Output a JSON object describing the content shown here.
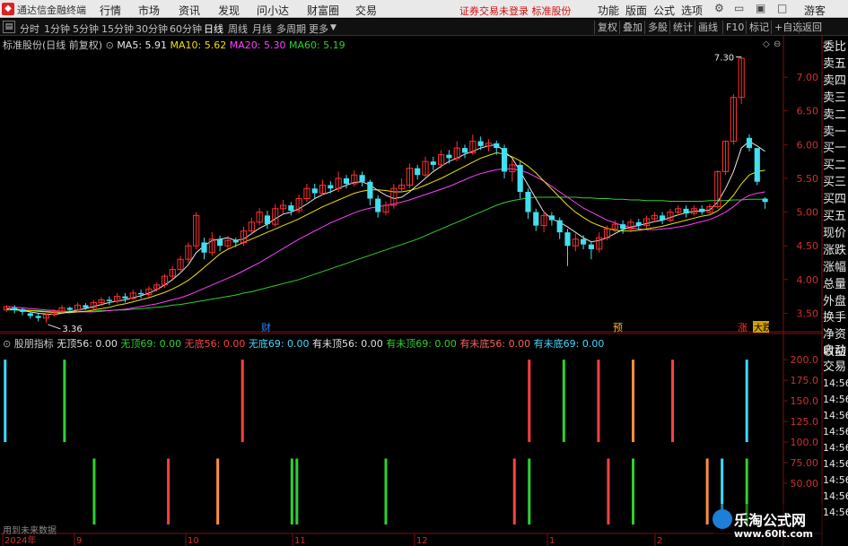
{
  "menubar": {
    "title": "通达信金融终端",
    "items": [
      "行情",
      "市场",
      "资讯",
      "发现",
      "问小达",
      "财富圈",
      "交易"
    ],
    "warning": "证券交易未登录  标准股份",
    "right_items": [
      "功能",
      "版面",
      "公式",
      "选项"
    ],
    "user": "游客"
  },
  "toolbar": {
    "periods": [
      "分时",
      "1分钟",
      "5分钟",
      "15分钟",
      "30分钟",
      "60分钟",
      "日线",
      "周线",
      "月线",
      "多周期",
      "更多"
    ],
    "active_period": "日线",
    "right_buttons": [
      "复权",
      "叠加",
      "多股",
      "统计",
      "画线",
      "F10",
      "标记",
      "+自选",
      "返回"
    ]
  },
  "main_legend": {
    "stock": "标准股份(日线 前复权)",
    "ma": [
      {
        "label": "MA5: 5.91",
        "color": "#e8e8e8"
      },
      {
        "label": "MA10: 5.62",
        "color": "#f0e000"
      },
      {
        "label": "MA20: 5.30",
        "color": "#ff40ff"
      },
      {
        "label": "MA60: 5.19",
        "color": "#30d030"
      }
    ]
  },
  "indicator": {
    "name": "股朋指标",
    "values": [
      {
        "label": "无顶56: 0.00",
        "color": "#e0e0e0"
      },
      {
        "label": "无顶69: 0.00",
        "color": "#30d030"
      },
      {
        "label": "无底56: 0.00",
        "color": "#ff4040"
      },
      {
        "label": "无底69: 0.00",
        "color": "#40d8ff"
      },
      {
        "label": "有未顶56: 0.00",
        "color": "#e0e0e0"
      },
      {
        "label": "有未顶69: 0.00",
        "color": "#30d030"
      },
      {
        "label": "有未底56: 0.00",
        "color": "#ff6060"
      },
      {
        "label": "有未底69: 0.00",
        "color": "#40d8ff"
      }
    ]
  },
  "price_axis": [
    "7.00",
    "6.50",
    "6.00",
    "5.50",
    "5.00",
    "4.50",
    "4.00",
    "3.50"
  ],
  "indicator_axis": [
    "200.0",
    "175.0",
    "150.0",
    "125.0",
    "100.0",
    "75.00",
    "50.00"
  ],
  "date_axis": [
    "2024年",
    "9",
    "10",
    "11",
    "12",
    "1",
    "2"
  ],
  "annotations": {
    "high": "7.30",
    "low": "3.36",
    "marker_cai": "财",
    "marker_yu": "预",
    "marker_zhang": "涨",
    "marker_tag": "大跌"
  },
  "side_list": [
    "委比",
    "卖五",
    "卖四",
    "卖三",
    "卖二",
    "卖一",
    "买一",
    "买二",
    "买三",
    "买四",
    "买五",
    "现价",
    "涨跌",
    "涨幅",
    "总量",
    "外盘",
    "换手",
    "净资",
    "收益"
  ],
  "side_list_lower": [
    "自动",
    "交易",
    "14:56",
    "14:56",
    "14:56",
    "14:56",
    "14:56",
    "14:56",
    "14:56",
    "14:56",
    "14:56"
  ],
  "note": "用到未来数据",
  "watermark": {
    "cn": "乐淘公式网",
    "url": "www.60lt.com"
  },
  "chart_data": {
    "type": "candlestick",
    "ylim": [
      3.2,
      7.4
    ],
    "candles": [
      [
        3.55,
        3.6,
        3.52,
        3.62
      ],
      [
        3.58,
        3.56,
        3.5,
        3.62
      ],
      [
        3.56,
        3.52,
        3.47,
        3.58
      ],
      [
        3.5,
        3.46,
        3.42,
        3.53
      ],
      [
        3.46,
        3.43,
        3.38,
        3.5
      ],
      [
        3.43,
        3.48,
        3.36,
        3.5
      ],
      [
        3.48,
        3.53,
        3.45,
        3.56
      ],
      [
        3.53,
        3.58,
        3.5,
        3.62
      ],
      [
        3.58,
        3.55,
        3.5,
        3.6
      ],
      [
        3.55,
        3.62,
        3.52,
        3.66
      ],
      [
        3.62,
        3.58,
        3.55,
        3.65
      ],
      [
        3.58,
        3.66,
        3.56,
        3.7
      ],
      [
        3.66,
        3.7,
        3.6,
        3.74
      ],
      [
        3.7,
        3.68,
        3.62,
        3.75
      ],
      [
        3.68,
        3.75,
        3.65,
        3.8
      ],
      [
        3.75,
        3.72,
        3.66,
        3.8
      ],
      [
        3.72,
        3.8,
        3.7,
        3.85
      ],
      [
        3.8,
        3.78,
        3.72,
        3.85
      ],
      [
        3.78,
        3.86,
        3.74,
        3.9
      ],
      [
        3.86,
        3.92,
        3.82,
        3.96
      ],
      [
        3.92,
        4.05,
        3.88,
        4.08
      ],
      [
        4.05,
        4.15,
        4.0,
        4.2
      ],
      [
        4.15,
        4.3,
        4.1,
        4.35
      ],
      [
        4.3,
        4.5,
        4.25,
        4.55
      ],
      [
        4.5,
        4.95,
        4.45,
        5.0
      ],
      [
        4.55,
        4.4,
        4.3,
        4.62
      ],
      [
        4.4,
        4.6,
        4.35,
        4.7
      ],
      [
        4.6,
        4.5,
        4.42,
        4.65
      ],
      [
        4.5,
        4.58,
        4.45,
        4.65
      ],
      [
        4.58,
        4.55,
        4.48,
        4.62
      ],
      [
        4.55,
        4.72,
        4.5,
        4.78
      ],
      [
        4.72,
        4.85,
        4.68,
        4.92
      ],
      [
        4.85,
        5.0,
        4.8,
        5.06
      ],
      [
        4.95,
        4.82,
        4.75,
        5.02
      ],
      [
        4.82,
        5.05,
        4.78,
        5.12
      ],
      [
        5.05,
        5.1,
        4.98,
        5.18
      ],
      [
        5.1,
        5.02,
        4.95,
        5.15
      ],
      [
        5.02,
        5.2,
        4.98,
        5.26
      ],
      [
        5.2,
        5.35,
        5.15,
        5.42
      ],
      [
        5.35,
        5.28,
        5.2,
        5.42
      ],
      [
        5.28,
        5.4,
        5.25,
        5.48
      ],
      [
        5.4,
        5.35,
        5.28,
        5.46
      ],
      [
        5.35,
        5.5,
        5.3,
        5.6
      ],
      [
        5.5,
        5.42,
        5.35,
        5.55
      ],
      [
        5.42,
        5.55,
        5.38,
        5.62
      ],
      [
        5.55,
        5.45,
        5.38,
        5.6
      ],
      [
        5.45,
        5.2,
        5.1,
        5.48
      ],
      [
        5.2,
        5.0,
        4.92,
        5.25
      ],
      [
        5.0,
        5.1,
        4.95,
        5.16
      ],
      [
        5.1,
        5.35,
        5.05,
        5.42
      ],
      [
        5.35,
        5.4,
        5.3,
        5.5
      ],
      [
        5.4,
        5.65,
        5.35,
        5.72
      ],
      [
        5.65,
        5.55,
        5.48,
        5.7
      ],
      [
        5.55,
        5.75,
        5.5,
        5.82
      ],
      [
        5.75,
        5.7,
        5.62,
        5.82
      ],
      [
        5.7,
        5.85,
        5.65,
        5.92
      ],
      [
        5.85,
        5.8,
        5.72,
        5.92
      ],
      [
        5.8,
        5.95,
        5.75,
        6.05
      ],
      [
        5.95,
        5.88,
        5.8,
        6.0
      ],
      [
        5.88,
        6.05,
        5.85,
        6.15
      ],
      [
        6.05,
        5.98,
        5.92,
        6.12
      ],
      [
        5.98,
        6.02,
        5.9,
        6.08
      ],
      [
        6.02,
        5.95,
        5.85,
        6.06
      ],
      [
        5.95,
        5.6,
        5.5,
        6.0
      ],
      [
        5.6,
        5.7,
        5.45,
        5.78
      ],
      [
        5.7,
        5.3,
        5.2,
        5.75
      ],
      [
        5.3,
        5.0,
        4.9,
        5.35
      ],
      [
        5.0,
        4.8,
        4.72,
        5.05
      ],
      [
        4.8,
        4.95,
        4.7,
        5.02
      ],
      [
        4.95,
        4.88,
        4.8,
        5.0
      ],
      [
        4.88,
        4.7,
        4.6,
        4.92
      ],
      [
        4.7,
        4.5,
        4.2,
        4.75
      ],
      [
        4.5,
        4.6,
        4.42,
        4.68
      ],
      [
        4.6,
        4.52,
        4.45,
        4.66
      ],
      [
        4.52,
        4.45,
        4.3,
        4.56
      ],
      [
        4.45,
        4.62,
        4.4,
        4.7
      ],
      [
        4.62,
        4.75,
        4.58,
        4.8
      ],
      [
        4.75,
        4.82,
        4.7,
        4.88
      ],
      [
        4.82,
        4.75,
        4.68,
        4.88
      ],
      [
        4.75,
        4.85,
        4.7,
        4.9
      ],
      [
        4.85,
        4.8,
        4.74,
        4.9
      ],
      [
        4.8,
        4.9,
        4.76,
        4.95
      ],
      [
        4.9,
        4.95,
        4.85,
        5.0
      ],
      [
        4.95,
        4.88,
        4.82,
        5.0
      ],
      [
        4.88,
        5.0,
        4.85,
        5.05
      ],
      [
        5.0,
        5.05,
        4.95,
        5.1
      ],
      [
        5.05,
        4.98,
        4.92,
        5.1
      ],
      [
        4.98,
        5.05,
        4.95,
        5.1
      ],
      [
        5.05,
        5.0,
        4.96,
        5.1
      ],
      [
        5.0,
        5.08,
        4.96,
        5.12
      ],
      [
        5.08,
        5.6,
        5.05,
        5.62
      ],
      [
        5.6,
        6.05,
        5.55,
        6.06
      ],
      [
        6.05,
        6.7,
        6.0,
        6.75
      ],
      [
        6.7,
        7.28,
        6.6,
        7.3
      ],
      [
        6.1,
        5.95,
        5.9,
        6.15
      ],
      [
        5.95,
        5.45,
        5.4,
        5.5
      ],
      [
        5.2,
        5.15,
        5.05,
        5.22
      ]
    ],
    "ma5": [
      3.57,
      3.56,
      3.54,
      3.52,
      3.5,
      3.49,
      3.48,
      3.5,
      3.52,
      3.55,
      3.57,
      3.6,
      3.63,
      3.66,
      3.68,
      3.7,
      3.73,
      3.76,
      3.8,
      3.85,
      3.92,
      4.0,
      4.1,
      4.22,
      4.4,
      4.5,
      4.58,
      4.6,
      4.62,
      4.58,
      4.6,
      4.68,
      4.76,
      4.82,
      4.9,
      4.97,
      5.0,
      5.05,
      5.12,
      5.2,
      5.26,
      5.3,
      5.35,
      5.4,
      5.44,
      5.45,
      5.4,
      5.32,
      5.25,
      5.2,
      5.22,
      5.3,
      5.4,
      5.5,
      5.6,
      5.68,
      5.75,
      5.8,
      5.86,
      5.9,
      5.95,
      5.98,
      6.0,
      5.9,
      5.8,
      5.6,
      5.4,
      5.2,
      5.0,
      4.9,
      4.85,
      4.78,
      4.7,
      4.62,
      4.56,
      4.58,
      4.62,
      4.68,
      4.74,
      4.78,
      4.8,
      4.83,
      4.86,
      4.88,
      4.92,
      4.96,
      4.99,
      5.01,
      5.02,
      5.03,
      5.15,
      5.35,
      5.6,
      5.95,
      6.05,
      5.98,
      5.9
    ],
    "ma10": [
      3.56,
      3.56,
      3.55,
      3.54,
      3.53,
      3.52,
      3.51,
      3.51,
      3.51,
      3.52,
      3.53,
      3.55,
      3.57,
      3.59,
      3.62,
      3.64,
      3.67,
      3.7,
      3.73,
      3.77,
      3.81,
      3.86,
      3.92,
      3.99,
      4.08,
      4.18,
      4.28,
      4.38,
      4.45,
      4.5,
      4.55,
      4.6,
      4.65,
      4.7,
      4.75,
      4.8,
      4.85,
      4.9,
      4.96,
      5.02,
      5.08,
      5.13,
      5.18,
      5.23,
      5.28,
      5.31,
      5.33,
      5.33,
      5.32,
      5.3,
      5.3,
      5.32,
      5.35,
      5.4,
      5.45,
      5.5,
      5.56,
      5.62,
      5.68,
      5.74,
      5.8,
      5.84,
      5.88,
      5.86,
      5.82,
      5.76,
      5.68,
      5.58,
      5.46,
      5.34,
      5.22,
      5.1,
      5.0,
      4.92,
      4.85,
      4.8,
      4.76,
      4.73,
      4.72,
      4.72,
      4.73,
      4.75,
      4.77,
      4.79,
      4.82,
      4.85,
      4.88,
      4.91,
      4.94,
      4.96,
      5.02,
      5.12,
      5.25,
      5.42,
      5.55,
      5.6,
      5.62
    ],
    "ma20": [
      3.6,
      3.59,
      3.58,
      3.57,
      3.56,
      3.55,
      3.54,
      3.53,
      3.52,
      3.52,
      3.52,
      3.52,
      3.53,
      3.54,
      3.55,
      3.56,
      3.58,
      3.6,
      3.62,
      3.64,
      3.67,
      3.7,
      3.73,
      3.77,
      3.82,
      3.87,
      3.92,
      3.97,
      4.02,
      4.07,
      4.13,
      4.19,
      4.25,
      4.32,
      4.39,
      4.46,
      4.53,
      4.6,
      4.66,
      4.72,
      4.78,
      4.84,
      4.89,
      4.94,
      4.99,
      5.03,
      5.06,
      5.08,
      5.1,
      5.12,
      5.15,
      5.18,
      5.22,
      5.26,
      5.3,
      5.34,
      5.38,
      5.43,
      5.48,
      5.53,
      5.57,
      5.6,
      5.63,
      5.64,
      5.64,
      5.62,
      5.58,
      5.52,
      5.46,
      5.38,
      5.3,
      5.22,
      5.14,
      5.06,
      5.0,
      4.94,
      4.88,
      4.84,
      4.8,
      4.77,
      4.75,
      4.74,
      4.74,
      4.75,
      4.76,
      4.78,
      4.8,
      4.83,
      4.86,
      4.89,
      4.94,
      5.0,
      5.08,
      5.18,
      5.25,
      5.28,
      5.3
    ],
    "ma60": [
      3.55,
      3.55,
      3.54,
      3.54,
      3.54,
      3.53,
      3.53,
      3.53,
      3.53,
      3.53,
      3.53,
      3.53,
      3.54,
      3.54,
      3.55,
      3.55,
      3.56,
      3.57,
      3.58,
      3.59,
      3.6,
      3.62,
      3.63,
      3.65,
      3.67,
      3.69,
      3.71,
      3.73,
      3.75,
      3.77,
      3.8,
      3.82,
      3.85,
      3.88,
      3.91,
      3.94,
      3.97,
      4.0,
      4.04,
      4.08,
      4.12,
      4.16,
      4.2,
      4.24,
      4.28,
      4.32,
      4.36,
      4.4,
      4.44,
      4.48,
      4.52,
      4.56,
      4.6,
      4.65,
      4.7,
      4.75,
      4.8,
      4.85,
      4.9,
      4.95,
      5.0,
      5.05,
      5.1,
      5.14,
      5.17,
      5.19,
      5.21,
      5.22,
      5.22,
      5.22,
      5.22,
      5.22,
      5.22,
      5.21,
      5.21,
      5.2,
      5.2,
      5.19,
      5.19,
      5.18,
      5.18,
      5.17,
      5.17,
      5.17,
      5.16,
      5.16,
      5.16,
      5.16,
      5.16,
      5.17,
      5.17,
      5.17,
      5.18,
      5.18,
      5.19,
      5.19,
      5.19
    ],
    "indicator_ylim": [
      0,
      210
    ],
    "indicator_bars": [
      {
        "i": 0,
        "top": 200,
        "bottom": 100,
        "color": "#40d8ff"
      },
      {
        "i": 12,
        "top": 200,
        "bottom": 100,
        "color": "#30d030"
      },
      {
        "i": 18,
        "top": 80,
        "bottom": 0,
        "color": "#30d030"
      },
      {
        "i": 33,
        "top": 80,
        "bottom": 0,
        "color": "#ff4040"
      },
      {
        "i": 43,
        "top": 80,
        "bottom": 0,
        "color": "#ff9040"
      },
      {
        "i": 48,
        "top": 200,
        "bottom": 100,
        "color": "#ff4040"
      },
      {
        "i": 58,
        "top": 80,
        "bottom": 0,
        "color": "#30d030"
      },
      {
        "i": 59,
        "top": 80,
        "bottom": 0,
        "color": "#30d030"
      },
      {
        "i": 77,
        "top": 80,
        "bottom": 0,
        "color": "#30d030"
      },
      {
        "i": 103,
        "top": 80,
        "bottom": 0,
        "color": "#ff4040"
      },
      {
        "i": 106,
        "top": 200,
        "bottom": 100,
        "color": "#ff4040"
      },
      {
        "i": 106,
        "top": 80,
        "bottom": 0,
        "color": "#30d030"
      },
      {
        "i": 113,
        "top": 200,
        "bottom": 100,
        "color": "#30d030"
      },
      {
        "i": 120,
        "top": 200,
        "bottom": 100,
        "color": "#ff4040"
      },
      {
        "i": 122,
        "top": 80,
        "bottom": 0,
        "color": "#ff4040"
      },
      {
        "i": 127,
        "top": 200,
        "bottom": 100,
        "color": "#ff9040"
      },
      {
        "i": 127,
        "top": 80,
        "bottom": 0,
        "color": "#30d030"
      },
      {
        "i": 135,
        "top": 200,
        "bottom": 100,
        "color": "#ff4040"
      },
      {
        "i": 142,
        "top": 80,
        "bottom": 0,
        "color": "#ff9040"
      },
      {
        "i": 145,
        "top": 80,
        "bottom": 0,
        "color": "#40d8ff"
      },
      {
        "i": 150,
        "top": 200,
        "bottom": 100,
        "color": "#40d8ff"
      },
      {
        "i": 150,
        "top": 80,
        "bottom": 0,
        "color": "#30d030"
      }
    ]
  }
}
